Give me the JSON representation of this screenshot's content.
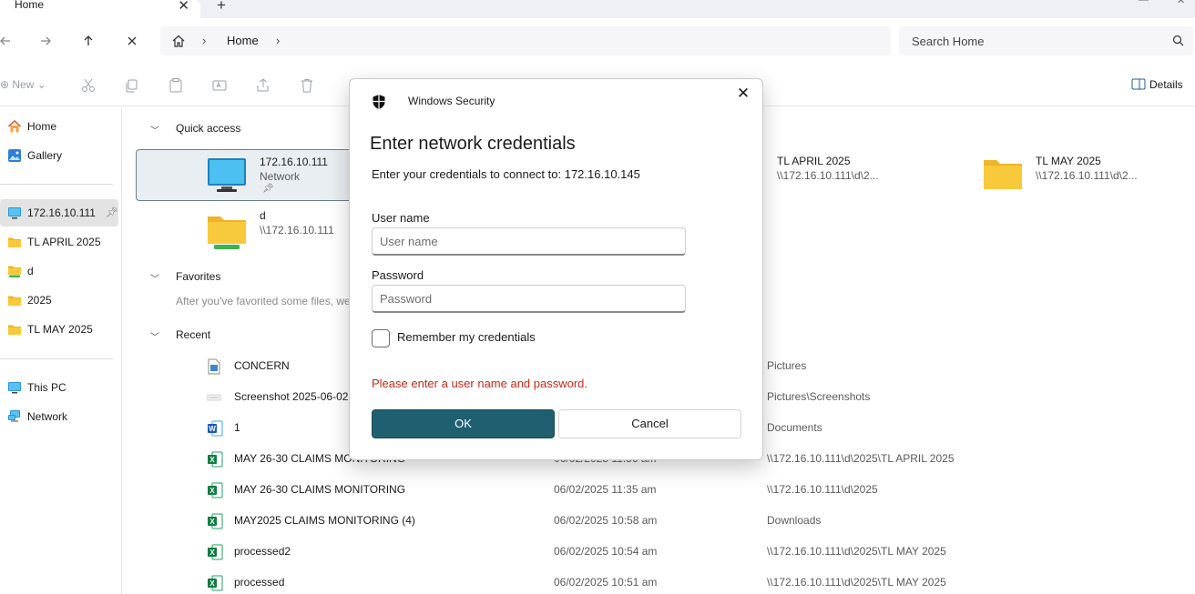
{
  "tabbar": {
    "tab_label": "Home",
    "close_glyph": "✕",
    "new_tab_glyph": "+"
  },
  "address": {
    "path": [
      "Home"
    ],
    "search_placeholder": "Search Home"
  },
  "commands": {
    "new_label": "New",
    "details_label": "Details"
  },
  "sidebar": {
    "items": [
      {
        "label": "Home",
        "icon": "home-icon"
      },
      {
        "label": "Gallery",
        "icon": "gallery-icon"
      },
      {
        "label": "172.16.10.111",
        "icon": "monitor-icon",
        "pinned": true,
        "selected": true
      },
      {
        "label": "TL APRIL 2025",
        "icon": "folder-icon"
      },
      {
        "label": "d",
        "icon": "network-drive-icon"
      },
      {
        "label": "2025",
        "icon": "folder-icon"
      },
      {
        "label": "TL MAY 2025",
        "icon": "folder-icon"
      },
      {
        "label": "This PC",
        "icon": "pc-icon"
      },
      {
        "label": "Network",
        "icon": "network-icon"
      }
    ]
  },
  "main": {
    "quick_access": {
      "heading": "Quick access",
      "items": [
        {
          "name": "172.16.10.111",
          "sub": "Network",
          "pinned": true
        },
        {
          "name": "d",
          "sub": "\\\\172.16.10.111"
        },
        {
          "name": "TL APRIL 2025",
          "sub": "\\\\172.16.10.111\\d\\2..."
        },
        {
          "name": "TL MAY 2025",
          "sub": "\\\\172.16.10.111\\d\\2..."
        }
      ]
    },
    "favorites": {
      "heading": "Favorites",
      "empty_text": "After you've favorited some files, we"
    },
    "recent": {
      "heading": "Recent",
      "rows": [
        {
          "name": "CONCERN",
          "date": "",
          "location": "Pictures",
          "icon": "image-file-icon"
        },
        {
          "name": "Screenshot 2025-06-02",
          "date": "",
          "location": "Pictures\\Screenshots",
          "icon": "screenshot-file-icon"
        },
        {
          "name": "1",
          "date": "",
          "location": "Documents",
          "icon": "word-file-icon"
        },
        {
          "name": "MAY 26-30 CLAIMS MONITORING",
          "date": "06/02/2025 11:36 am",
          "location": "\\\\172.16.10.111\\d\\2025\\TL APRIL 2025",
          "icon": "excel-file-icon"
        },
        {
          "name": "MAY 26-30 CLAIMS MONITORING",
          "date": "06/02/2025 11:35 am",
          "location": "\\\\172.16.10.111\\d\\2025",
          "icon": "excel-file-icon"
        },
        {
          "name": "MAY2025 CLAIMS MONITORING (4)",
          "date": "06/02/2025 10:58 am",
          "location": "Downloads",
          "icon": "excel-file-icon"
        },
        {
          "name": "processed2",
          "date": "06/02/2025 10:54 am",
          "location": "\\\\172.16.10.111\\d\\2025\\TL MAY 2025",
          "icon": "excel-file-icon"
        },
        {
          "name": "processed",
          "date": "06/02/2025 10:51 am",
          "location": "\\\\172.16.10.111\\d\\2025\\TL MAY 2025",
          "icon": "excel-file-icon"
        }
      ]
    }
  },
  "dialog": {
    "app_name": "Windows Security",
    "close_glyph": "✕",
    "title": "Enter network credentials",
    "subtitle": "Enter your credentials to connect to: 172.16.10.145",
    "username_label": "User name",
    "username_placeholder": "User name",
    "username_value": "",
    "password_label": "Password",
    "password_placeholder": "Password",
    "password_value": "",
    "remember_label": "Remember my credentials",
    "remember_checked": false,
    "error": "Please enter a user name and password.",
    "ok_label": "OK",
    "cancel_label": "Cancel"
  },
  "colors": {
    "accent": "#1f5f6f",
    "error": "#c42b1c",
    "folder": "#f8c93b"
  }
}
